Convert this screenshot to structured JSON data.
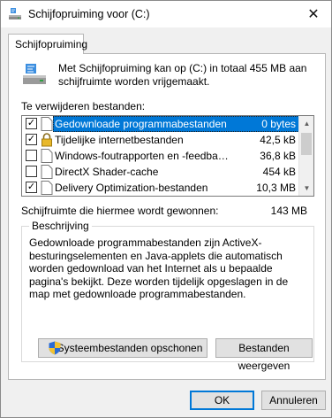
{
  "window": {
    "title": "Schijfopruiming voor  (C:)",
    "close_glyph": "✕"
  },
  "tab": {
    "label": "Schijfopruiming"
  },
  "intro": {
    "text": "Met Schijfopruiming kan op  (C:) in totaal 455 MB aan schijfruimte worden vrijgemaakt."
  },
  "files_section": {
    "label": "Te verwijderen bestanden:"
  },
  "files": [
    {
      "name": "Gedownloade programmabestanden",
      "size": "0 bytes",
      "checked": true,
      "selected": true,
      "icon": "blank-file-icon"
    },
    {
      "name": "Tijdelijke internetbestanden",
      "size": "42,5 kB",
      "checked": true,
      "selected": false,
      "icon": "lock-icon"
    },
    {
      "name": "Windows-foutrapporten en -feedbackdi...",
      "size": "36,8 kB",
      "checked": false,
      "selected": false,
      "icon": "blank-file-icon"
    },
    {
      "name": "DirectX Shader-cache",
      "size": "454 kB",
      "checked": false,
      "selected": false,
      "icon": "blank-file-icon"
    },
    {
      "name": "Delivery Optimization-bestanden",
      "size": "10,3 MB",
      "checked": true,
      "selected": false,
      "icon": "blank-file-icon"
    }
  ],
  "gain": {
    "label": "Schijfruimte die hiermee wordt gewonnen:",
    "value": "143 MB"
  },
  "description": {
    "title": "Beschrijving",
    "text": "Gedownloade programmabestanden zijn ActiveX-besturingselementen en Java-applets die automatisch worden gedownload van het Internet als u bepaalde pagina's bekijkt. Deze worden tijdelijk opgeslagen in de map met gedownloade programmabestanden."
  },
  "buttons": {
    "cleanup_system": "Systeembestanden opschonen",
    "view_files": "Bestanden weergeven",
    "ok": "OK",
    "cancel": "Annuleren"
  },
  "colors": {
    "selection": "#0078d7",
    "button_face": "#e1e1e1"
  }
}
